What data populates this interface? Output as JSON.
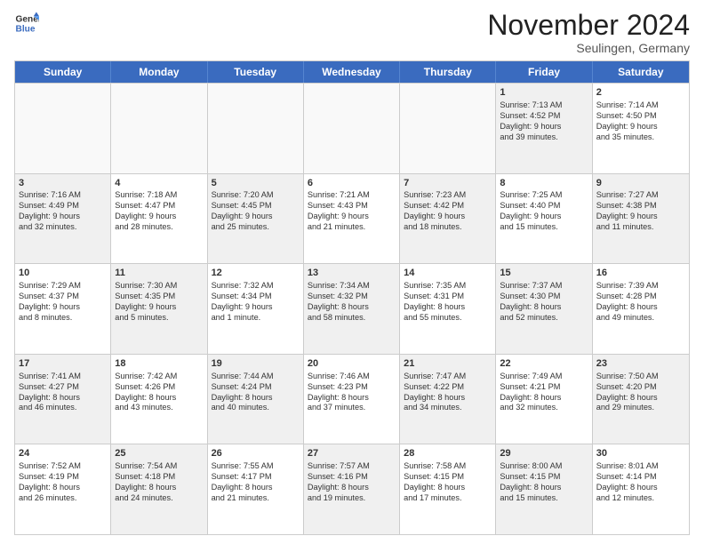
{
  "logo": {
    "line1": "General",
    "line2": "Blue"
  },
  "header": {
    "month": "November 2024",
    "location": "Seulingen, Germany"
  },
  "weekdays": [
    "Sunday",
    "Monday",
    "Tuesday",
    "Wednesday",
    "Thursday",
    "Friday",
    "Saturday"
  ],
  "rows": [
    [
      {
        "day": "",
        "text": "",
        "empty": true
      },
      {
        "day": "",
        "text": "",
        "empty": true
      },
      {
        "day": "",
        "text": "",
        "empty": true
      },
      {
        "day": "",
        "text": "",
        "empty": true
      },
      {
        "day": "",
        "text": "",
        "empty": true
      },
      {
        "day": "1",
        "text": "Sunrise: 7:13 AM\nSunset: 4:52 PM\nDaylight: 9 hours\nand 39 minutes.",
        "shaded": true
      },
      {
        "day": "2",
        "text": "Sunrise: 7:14 AM\nSunset: 4:50 PM\nDaylight: 9 hours\nand 35 minutes.",
        "shaded": false
      }
    ],
    [
      {
        "day": "3",
        "text": "Sunrise: 7:16 AM\nSunset: 4:49 PM\nDaylight: 9 hours\nand 32 minutes.",
        "shaded": true
      },
      {
        "day": "4",
        "text": "Sunrise: 7:18 AM\nSunset: 4:47 PM\nDaylight: 9 hours\nand 28 minutes.",
        "shaded": false
      },
      {
        "day": "5",
        "text": "Sunrise: 7:20 AM\nSunset: 4:45 PM\nDaylight: 9 hours\nand 25 minutes.",
        "shaded": true
      },
      {
        "day": "6",
        "text": "Sunrise: 7:21 AM\nSunset: 4:43 PM\nDaylight: 9 hours\nand 21 minutes.",
        "shaded": false
      },
      {
        "day": "7",
        "text": "Sunrise: 7:23 AM\nSunset: 4:42 PM\nDaylight: 9 hours\nand 18 minutes.",
        "shaded": true
      },
      {
        "day": "8",
        "text": "Sunrise: 7:25 AM\nSunset: 4:40 PM\nDaylight: 9 hours\nand 15 minutes.",
        "shaded": false
      },
      {
        "day": "9",
        "text": "Sunrise: 7:27 AM\nSunset: 4:38 PM\nDaylight: 9 hours\nand 11 minutes.",
        "shaded": true
      }
    ],
    [
      {
        "day": "10",
        "text": "Sunrise: 7:29 AM\nSunset: 4:37 PM\nDaylight: 9 hours\nand 8 minutes.",
        "shaded": false
      },
      {
        "day": "11",
        "text": "Sunrise: 7:30 AM\nSunset: 4:35 PM\nDaylight: 9 hours\nand 5 minutes.",
        "shaded": true
      },
      {
        "day": "12",
        "text": "Sunrise: 7:32 AM\nSunset: 4:34 PM\nDaylight: 9 hours\nand 1 minute.",
        "shaded": false
      },
      {
        "day": "13",
        "text": "Sunrise: 7:34 AM\nSunset: 4:32 PM\nDaylight: 8 hours\nand 58 minutes.",
        "shaded": true
      },
      {
        "day": "14",
        "text": "Sunrise: 7:35 AM\nSunset: 4:31 PM\nDaylight: 8 hours\nand 55 minutes.",
        "shaded": false
      },
      {
        "day": "15",
        "text": "Sunrise: 7:37 AM\nSunset: 4:30 PM\nDaylight: 8 hours\nand 52 minutes.",
        "shaded": true
      },
      {
        "day": "16",
        "text": "Sunrise: 7:39 AM\nSunset: 4:28 PM\nDaylight: 8 hours\nand 49 minutes.",
        "shaded": false
      }
    ],
    [
      {
        "day": "17",
        "text": "Sunrise: 7:41 AM\nSunset: 4:27 PM\nDaylight: 8 hours\nand 46 minutes.",
        "shaded": true
      },
      {
        "day": "18",
        "text": "Sunrise: 7:42 AM\nSunset: 4:26 PM\nDaylight: 8 hours\nand 43 minutes.",
        "shaded": false
      },
      {
        "day": "19",
        "text": "Sunrise: 7:44 AM\nSunset: 4:24 PM\nDaylight: 8 hours\nand 40 minutes.",
        "shaded": true
      },
      {
        "day": "20",
        "text": "Sunrise: 7:46 AM\nSunset: 4:23 PM\nDaylight: 8 hours\nand 37 minutes.",
        "shaded": false
      },
      {
        "day": "21",
        "text": "Sunrise: 7:47 AM\nSunset: 4:22 PM\nDaylight: 8 hours\nand 34 minutes.",
        "shaded": true
      },
      {
        "day": "22",
        "text": "Sunrise: 7:49 AM\nSunset: 4:21 PM\nDaylight: 8 hours\nand 32 minutes.",
        "shaded": false
      },
      {
        "day": "23",
        "text": "Sunrise: 7:50 AM\nSunset: 4:20 PM\nDaylight: 8 hours\nand 29 minutes.",
        "shaded": true
      }
    ],
    [
      {
        "day": "24",
        "text": "Sunrise: 7:52 AM\nSunset: 4:19 PM\nDaylight: 8 hours\nand 26 minutes.",
        "shaded": false
      },
      {
        "day": "25",
        "text": "Sunrise: 7:54 AM\nSunset: 4:18 PM\nDaylight: 8 hours\nand 24 minutes.",
        "shaded": true
      },
      {
        "day": "26",
        "text": "Sunrise: 7:55 AM\nSunset: 4:17 PM\nDaylight: 8 hours\nand 21 minutes.",
        "shaded": false
      },
      {
        "day": "27",
        "text": "Sunrise: 7:57 AM\nSunset: 4:16 PM\nDaylight: 8 hours\nand 19 minutes.",
        "shaded": true
      },
      {
        "day": "28",
        "text": "Sunrise: 7:58 AM\nSunset: 4:15 PM\nDaylight: 8 hours\nand 17 minutes.",
        "shaded": false
      },
      {
        "day": "29",
        "text": "Sunrise: 8:00 AM\nSunset: 4:15 PM\nDaylight: 8 hours\nand 15 minutes.",
        "shaded": true
      },
      {
        "day": "30",
        "text": "Sunrise: 8:01 AM\nSunset: 4:14 PM\nDaylight: 8 hours\nand 12 minutes.",
        "shaded": false
      }
    ]
  ]
}
